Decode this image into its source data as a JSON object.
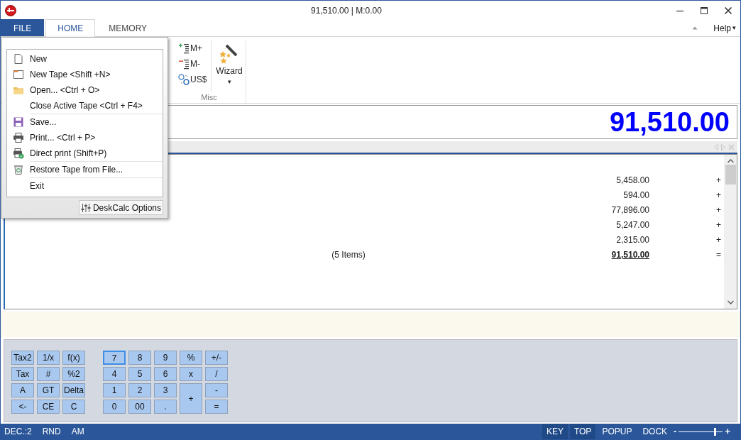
{
  "window": {
    "title": "91,510.00 | M:0.00"
  },
  "ribbon_tabs": [
    {
      "label": "FILE",
      "kind": "file",
      "selected": false
    },
    {
      "label": "HOME",
      "kind": "tab",
      "selected": true
    },
    {
      "label": "MEMORY",
      "kind": "tab",
      "selected": false
    }
  ],
  "help": {
    "label": "Help",
    "caret": "▾"
  },
  "ribbon_group": {
    "label": "Misc",
    "buttons": [
      {
        "label": "M+",
        "kind": "mplus"
      },
      {
        "label": "M-",
        "kind": "mminus"
      },
      {
        "label": "US$",
        "kind": "currency"
      }
    ],
    "wizard": {
      "label": "Wizard",
      "caret": "▾"
    }
  },
  "display": "91,510.00",
  "tape": {
    "rows": [
      {
        "kind": "entry",
        "value": "5,458.00",
        "op": "+"
      },
      {
        "kind": "entry",
        "value": "594.00",
        "op": "+"
      },
      {
        "kind": "entry",
        "value": "77,896.00",
        "op": "+"
      },
      {
        "kind": "entry",
        "value": "5,247.00",
        "op": "+"
      },
      {
        "kind": "entry",
        "value": "2,315.00",
        "op": "+"
      },
      {
        "kind": "total",
        "label": "(5 Items)",
        "value": "91,510.00",
        "op": "="
      }
    ]
  },
  "keypad": {
    "left": [
      {
        "label": "Tax2"
      },
      {
        "label": "1/x"
      },
      {
        "label": "f(x)"
      },
      {
        "label": "Tax"
      },
      {
        "label": "#"
      },
      {
        "label": "%2"
      },
      {
        "label": "A"
      },
      {
        "label": "GT"
      },
      {
        "label": "Delta"
      },
      {
        "label": "<-"
      },
      {
        "label": "CE"
      },
      {
        "label": "C"
      }
    ],
    "right": [
      {
        "label": "7",
        "focused": true
      },
      {
        "label": "8",
        "focused": false
      },
      {
        "label": "9",
        "focused": false
      },
      {
        "label": "%",
        "focused": false
      },
      {
        "label": "+/-",
        "focused": false
      },
      {
        "label": "4",
        "focused": false
      },
      {
        "label": "5",
        "focused": false
      },
      {
        "label": "6",
        "focused": false
      },
      {
        "label": "x",
        "focused": false
      },
      {
        "label": "/",
        "focused": false
      },
      {
        "label": "1",
        "focused": false
      },
      {
        "label": "2",
        "focused": false
      },
      {
        "label": "3",
        "focused": false
      },
      {
        "label": "+",
        "kind": "tall",
        "focused": false
      },
      {
        "label": "-",
        "focused": false
      },
      {
        "label": "0",
        "focused": false
      },
      {
        "label": "00",
        "focused": false
      },
      {
        "label": ".",
        "focused": false
      },
      {
        "label": "=",
        "focused": false
      }
    ]
  },
  "status_bar": {
    "left": [
      "DEC.:2",
      "RND",
      "AM"
    ],
    "toggles": [
      {
        "label": "KEY",
        "on": true
      },
      {
        "label": "TOP",
        "on": true
      },
      {
        "label": "POPUP",
        "on": false
      },
      {
        "label": "DOCK",
        "on": false
      }
    ],
    "zoom": {
      "minus": "-",
      "plus": "+",
      "level": 0.82
    }
  },
  "file_menu": {
    "sections": [
      [
        {
          "label": "New"
        },
        {
          "label": "New Tape <Shift +N>"
        },
        {
          "label": "Open... <Ctrl + O>"
        },
        {
          "label": "Close Active Tape <Ctrl + F4>"
        }
      ],
      [
        {
          "label": "Save..."
        },
        {
          "label": "Print... <Ctrl + P>"
        },
        {
          "label": "Direct print (Shift+P)"
        }
      ],
      [
        {
          "label": "Restore Tape from File..."
        }
      ],
      [
        {
          "label": "Exit"
        }
      ]
    ],
    "options": "DeskCalc Options"
  }
}
